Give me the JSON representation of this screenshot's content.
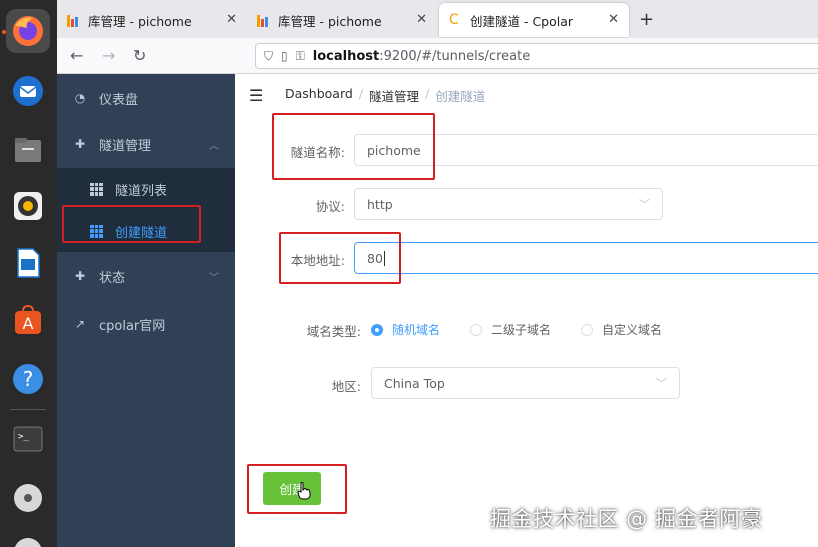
{
  "browser": {
    "tabs": [
      {
        "title": "库管理 - pichome"
      },
      {
        "title": "库管理 - pichome"
      },
      {
        "title": "创建隧道 - Cpolar"
      }
    ],
    "new_tab": "+",
    "url_host": "localhost",
    "url_rest": ":9200/#/tunnels/create"
  },
  "sidebar": {
    "items": [
      {
        "label": "仪表盘"
      },
      {
        "label": "隧道管理"
      },
      {
        "label": "隧道列表"
      },
      {
        "label": "创建隧道"
      },
      {
        "label": "状态"
      },
      {
        "label": "cpolar官网"
      }
    ]
  },
  "breadcrumb": [
    "Dashboard",
    "隧道管理",
    "创建隧道"
  ],
  "form": {
    "name_label": "隧道名称:",
    "name_value": "pichome",
    "protocol_label": "协议:",
    "protocol_value": "http",
    "local_label": "本地地址:",
    "local_value": "80",
    "domain_type_label": "域名类型:",
    "domain_options": [
      "随机域名",
      "二级子域名",
      "自定义域名"
    ],
    "region_label": "地区:",
    "region_value": "China Top",
    "submit_label": "创建"
  },
  "watermark": "掘金技术社区 @ 掘金者阿豪",
  "colors": {
    "sidebar_bg": "#304156",
    "submenu_bg": "#1f2d3d",
    "active": "#409eff",
    "success": "#67c23a",
    "annotation": "#d42020"
  }
}
